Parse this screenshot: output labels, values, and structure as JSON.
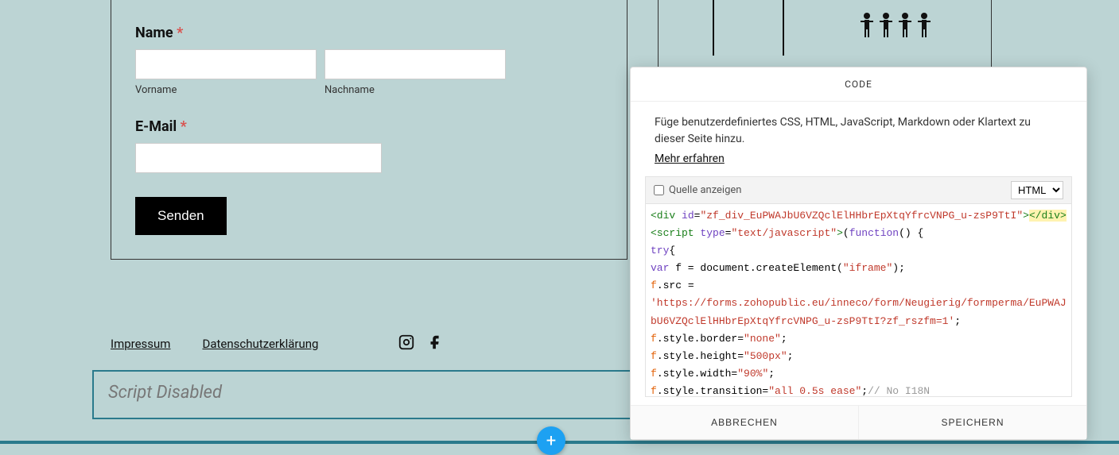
{
  "form": {
    "name_label": "Name ",
    "required": "*",
    "vorname_sub": "Vorname",
    "nachname_sub": "Nachname",
    "email_label": "E-Mail ",
    "send": "Senden"
  },
  "footer": {
    "impressum": "Impressum",
    "datenschutz": "Datenschutzerklärung"
  },
  "script_disabled": "Script Disabled",
  "code_panel": {
    "title": "CODE",
    "description": "Füge benutzerdefiniertes CSS, HTML, JavaScript, Markdown oder Klartext zu dieser Seite hinzu.",
    "learn_more": "Mehr erfahren",
    "show_source": "Quelle anzeigen",
    "lang_selected": "HTML",
    "cancel": "ABBRECHEN",
    "save": "SPEICHERN",
    "code": {
      "div_id": "\"zf_div_EuPWAJbU6VZQclElHHbrEpXtqYfrcVNPG_u-zsP9TtI\"",
      "src_url": "'https://forms.zohopublic.eu/inneco/form/Neugierig/formperma/EuPWAJbU6VZQclElHHbrEpXtqYfrcVNPG_u-zsP9TtI?zf_rszfm=1'",
      "border_val": "\"none\"",
      "height_val": "\"500px\"",
      "width_val": "\"90%\"",
      "transition_val": "\"all 0.5s ease\"",
      "i18n_comment": "// No I18N"
    }
  }
}
